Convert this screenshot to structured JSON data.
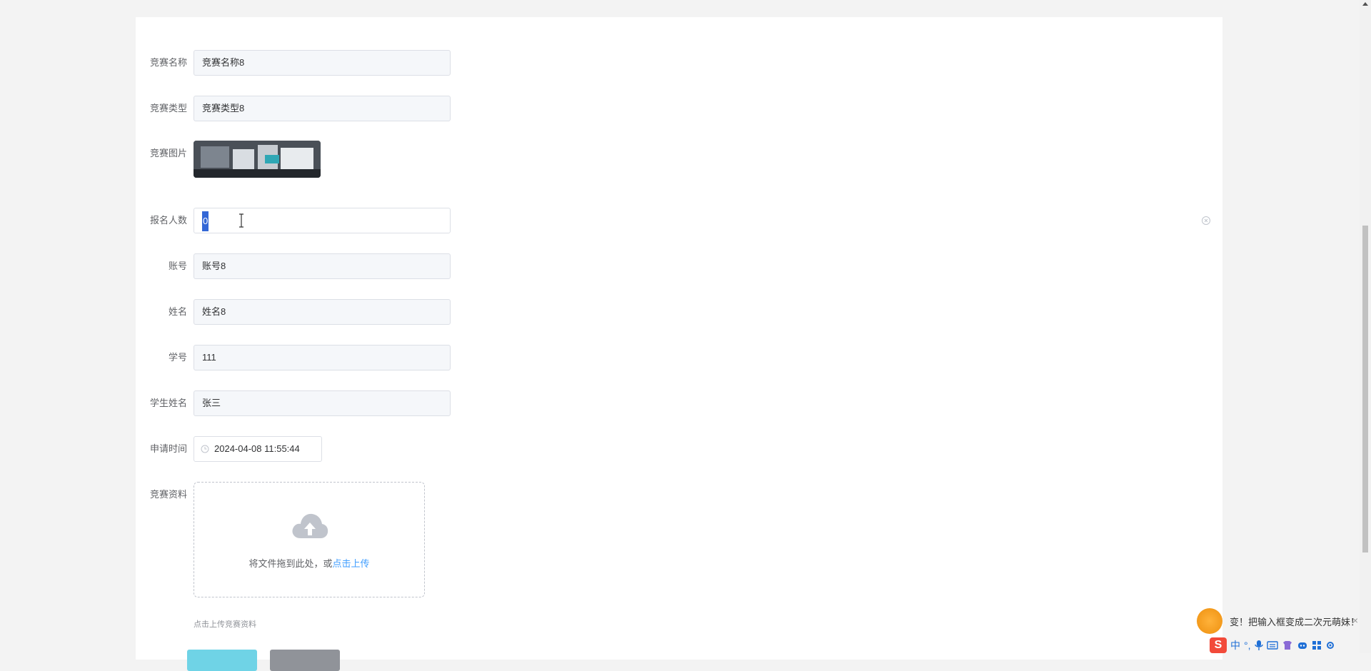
{
  "form": {
    "fields": [
      {
        "label": "竞赛名称",
        "value": "竞赛名称8"
      },
      {
        "label": "竞赛类型",
        "value": "竞赛类型8"
      }
    ],
    "image_label": "竞赛图片",
    "signup_label": "报名人数",
    "signup_value": "0",
    "fields2": [
      {
        "label": "账号",
        "value": "账号8"
      },
      {
        "label": "姓名",
        "value": "姓名8"
      },
      {
        "label": "学号",
        "value": "111"
      },
      {
        "label": "学生姓名",
        "value": "张三"
      }
    ],
    "apply_time_label": "申请时间",
    "apply_time_value": "2024-04-08 11:55:44",
    "material_label": "竞赛资料",
    "upload_hint_prefix": "将文件拖到此处，或",
    "upload_hint_link": "点击上传",
    "upload_tip": "点击上传竞赛资料"
  },
  "ime": {
    "popup_text": "变！把输入框变成二次元萌妹！",
    "close_glyph": "×",
    "logo": "S",
    "mode": "中",
    "punct": "°,"
  }
}
